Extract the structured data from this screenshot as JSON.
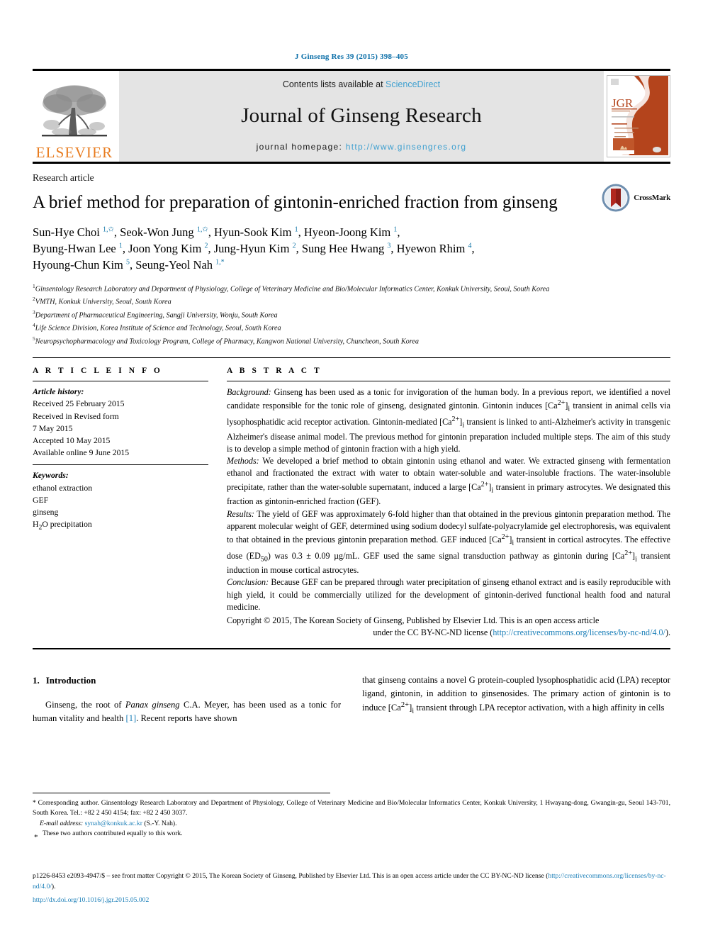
{
  "running_head": "J Ginseng Res 39 (2015) 398–405",
  "masthead": {
    "contents_prefix": "Contents lists available at ",
    "contents_link": "ScienceDirect",
    "journal_title": "Journal of Ginseng Research",
    "homepage_prefix": "journal homepage: ",
    "homepage_url": "http://www.ginsengres.org",
    "publisher_wordmark": "ELSEVIER",
    "cover_caption": "JGR"
  },
  "article": {
    "type": "Research article",
    "title": "A brief method for preparation of gintonin-enriched fraction from ginseng",
    "crossmark_label": "CrossMark",
    "authors_lines": [
      "Sun-Hye Choi 1,*, Seok-Won Jung 1,*, Hyun-Sook Kim 1, Hyeon-Joong Kim 1,",
      "Byung-Hwan Lee 1, Joon Yong Kim 2, Jung-Hyun Kim 2, Sung Hee Hwang 3, Hyewon Rhim 4,",
      "Hyoung-Chun Kim 5, Seung-Yeol Nah 1,*"
    ],
    "affiliations": [
      {
        "sup": "1",
        "text": "Ginsentology Research Laboratory and Department of Physiology, College of Veterinary Medicine and Bio/Molecular Informatics Center, Konkuk University, Seoul, South Korea"
      },
      {
        "sup": "2",
        "text": "VMTH, Konkuk University, Seoul, South Korea"
      },
      {
        "sup": "3",
        "text": "Department of Pharmaceutical Engineering, Sangji University, Wonju, South Korea"
      },
      {
        "sup": "4",
        "text": "Life Science Division, Korea Institute of Science and Technology, Seoul, South Korea"
      },
      {
        "sup": "5",
        "text": "Neuropsychopharmacology and Toxicology Program, College of Pharmacy, Kangwon National University, Chuncheon, South Korea"
      }
    ]
  },
  "article_info": {
    "heading": "A R T I C L E  I N F O",
    "history_label": "Article history:",
    "history_lines": [
      "Received 25 February 2015",
      "Received in Revised form",
      "7 May 2015",
      "Accepted 10 May 2015",
      "Available online 9 June 2015"
    ],
    "keywords_label": "Keywords:",
    "keywords": [
      "ethanol extraction",
      "GEF",
      "ginseng",
      "H2O precipitation"
    ]
  },
  "abstract": {
    "heading": "A B S T R A C T",
    "background_label": "Background:",
    "background_text": " Ginseng has been used as a tonic for invigoration of the human body. In a previous report, we identified a novel candidate responsible for the tonic role of ginseng, designated gintonin. Gintonin induces [Ca2+]i transient in animal cells via lysophosphatidic acid receptor activation. Gintonin-mediated [Ca2+]i transient is linked to anti-Alzheimer's activity in transgenic Alzheimer's disease animal model. The previous method for gintonin preparation included multiple steps. The aim of this study is to develop a simple method of gintonin fraction with a high yield.",
    "methods_label": "Methods:",
    "methods_text": " We developed a brief method to obtain gintonin using ethanol and water. We extracted ginseng with fermentation ethanol and fractionated the extract with water to obtain water-soluble and water-insoluble fractions. The water-insoluble precipitate, rather than the water-soluble supernatant, induced a large [Ca2+]i transient in primary astrocytes. We designated this fraction as gintonin-enriched fraction (GEF).",
    "results_label": "Results:",
    "results_text": " The yield of GEF was approximately 6-fold higher than that obtained in the previous gintonin preparation method. The apparent molecular weight of GEF, determined using sodium dodecyl sulfate-polyacrylamide gel electrophoresis, was equivalent to that obtained in the previous gintonin preparation method. GEF induced [Ca2+]i transient in cortical astrocytes. The effective dose (ED50) was 0.3 ± 0.09 µg/mL. GEF used the same signal transduction pathway as gintonin during [Ca2+]i transient induction in mouse cortical astrocytes.",
    "conclusion_label": "Conclusion:",
    "conclusion_text": " Because GEF can be prepared through water precipitation of ginseng ethanol extract and is easily reproducible with high yield, it could be commercially utilized for the development of gintonin-derived functional health food and natural medicine.",
    "copyright_line1": "Copyright © 2015, The Korean Society of Ginseng, Published by Elsevier Ltd. This is an open access article",
    "copyright_line2_prefix": "under the CC BY-NC-ND license (",
    "copyright_link": "http://creativecommons.org/licenses/by-nc-nd/4.0/",
    "copyright_line2_suffix": ")."
  },
  "intro": {
    "number": "1.",
    "heading": "Introduction",
    "left_text_a": "Ginseng, the root of ",
    "left_italic": "Panax ginseng",
    "left_text_b": " C.A. Meyer, has been used as a tonic for human vitality and health ",
    "left_ref": "[1]",
    "left_text_c": ". Recent reports have shown",
    "right_text": "that ginseng contains a novel G protein-coupled lysophosphatidic acid (LPA) receptor ligand, gintonin, in addition to ginsenosides. The primary action of gintonin is to induce [Ca2+]i transient through LPA receptor activation, with a high affinity in cells"
  },
  "footnotes": {
    "corresponding": "* Corresponding author. Ginsentology Research Laboratory and Department of Physiology, College of Veterinary Medicine and Bio/Molecular Informatics Center, Konkuk University, 1 Hwayang-dong, Gwangin-gu, Seoul 143-701, South Korea. Tel.: +82 2 450 4154; fax: +82 2 450 3037.",
    "email_label": "E-mail address:",
    "email": "synah@konkuk.ac.kr",
    "email_suffix": " (S.-Y. Nah).",
    "equal_mark": "*",
    "equal_text": "These two authors contributed equally to this work.",
    "issn_line_a": "p1226-8453 e2093-4947/$ – see front matter Copyright © 2015, The Korean Society of Ginseng, Published by Elsevier Ltd. This is an open access article under the CC BY-NC-ND license (",
    "issn_link": "http://creativecommons.org/licenses/by-nc-nd/4.0/",
    "issn_line_b": ").",
    "doi": "http://dx.doi.org/10.1016/j.jgr.2015.05.002"
  },
  "colors": {
    "link": "#1b7fb8",
    "sciencedirect": "#3fa0d0",
    "elsevier_orange": "#E87B1E",
    "running_head": "#0a6ea8"
  }
}
